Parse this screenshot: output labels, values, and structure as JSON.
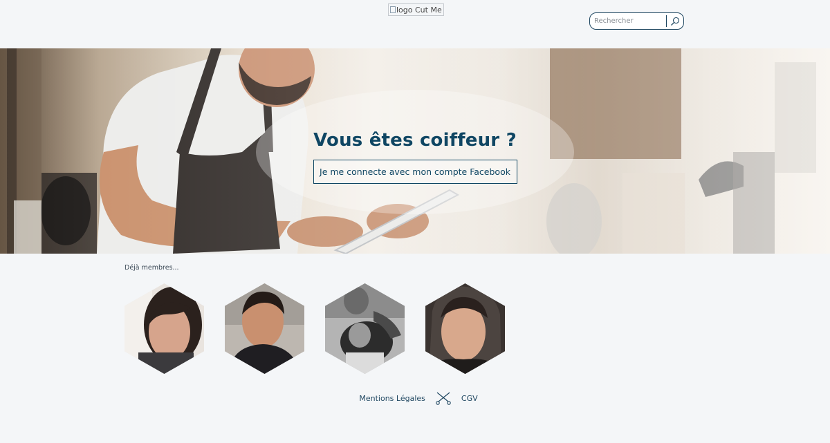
{
  "header": {
    "logo_alt": "logo Cut Me Go",
    "search_placeholder": "Rechercher"
  },
  "hero": {
    "title": "Vous êtes coiffeur ?",
    "facebook_button": "Je me connecte avec mon compte Facebook"
  },
  "members": {
    "label": "Déjà membres..."
  },
  "footer": {
    "legal": "Mentions Légales",
    "cgv": "CGV"
  },
  "colors": {
    "primary": "#0f4663",
    "background": "#f4f6f8"
  }
}
